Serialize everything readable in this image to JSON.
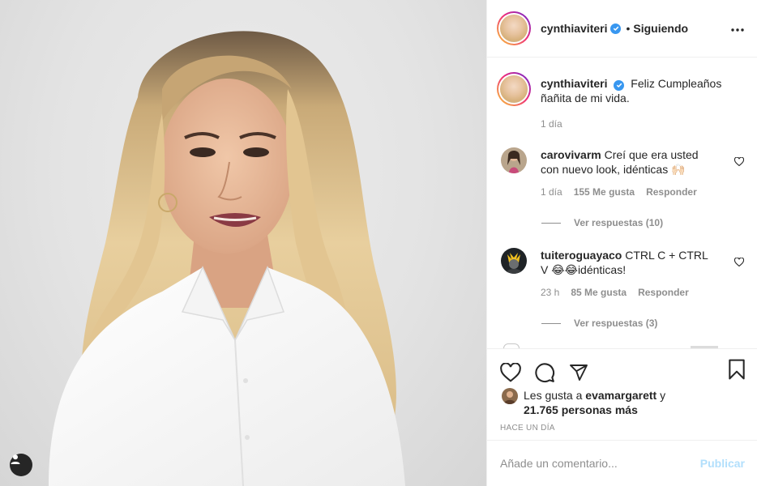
{
  "post": {
    "username": "cynthiaviteri",
    "follow_status": "Siguiendo",
    "separator": "•"
  },
  "caption": {
    "username": "cynthiaviteri",
    "text": "Feliz Cumpleaños ñañita de mi vida.",
    "time": "1 día"
  },
  "comments": [
    {
      "username": "carovivarm",
      "text": "Creí que era usted con nuevo look, idénticas 🙌🏻",
      "time": "1 día",
      "likes": "155 Me gusta",
      "reply_label": "Responder",
      "view_replies": "Ver respuestas (10)"
    },
    {
      "username": "tuiteroguayaco",
      "text": "CTRL C + CTRL V 😂😂idénticas!",
      "time": "23 h",
      "likes": "85 Me gusta",
      "reply_label": "Responder",
      "view_replies": "Ver respuestas (3)"
    }
  ],
  "likes": {
    "prefix": "Les gusta a",
    "user": "evamargarett",
    "joiner": "y",
    "others": "21.765 personas más"
  },
  "posted_ago": "HACE UN DÍA",
  "add_comment": {
    "placeholder": "Añade un comentario...",
    "publish_label": "Publicar"
  },
  "icons": [
    "user-tag-icon",
    "verified-badge-icon",
    "more-options-icon",
    "like-heart-icon",
    "comment-icon",
    "share-icon",
    "bookmark-icon"
  ],
  "colors": {
    "verified": "#3897f0",
    "muted": "#8e8e8e",
    "publish_disabled": "#b2dffc"
  }
}
